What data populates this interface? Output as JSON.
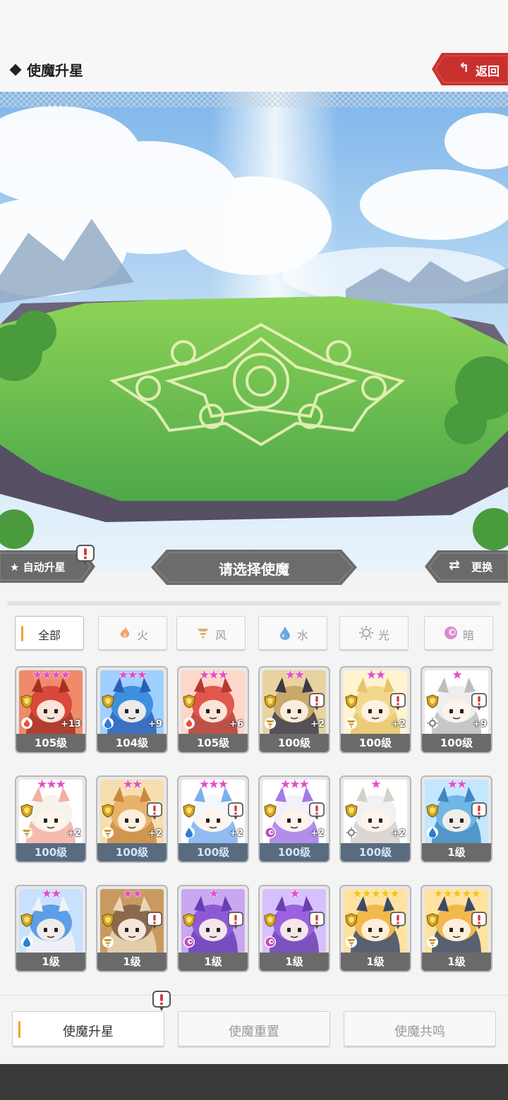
{
  "header": {
    "title": "使魔升星",
    "back_label": "返回"
  },
  "scene": {
    "auto_label": "自动升星",
    "select_label": "请选择使魔",
    "swap_label": "更换"
  },
  "filters": [
    {
      "label": "全部",
      "icon": "all",
      "active": true
    },
    {
      "label": "火",
      "icon": "fire-icon"
    },
    {
      "label": "风",
      "icon": "wind-icon"
    },
    {
      "label": "水",
      "icon": "water-icon"
    },
    {
      "label": "光",
      "icon": "light-icon"
    },
    {
      "label": "暗",
      "icon": "dark-icon"
    }
  ],
  "cards": [
    {
      "level": "105级",
      "stars": 4,
      "star_color": "pink",
      "plus": "+13",
      "element": "fire",
      "alert": false,
      "palette": [
        "#d9483a",
        "#a63024",
        "#f08a6a"
      ]
    },
    {
      "level": "104级",
      "stars": 3,
      "star_color": "pink",
      "plus": "+9",
      "element": "water",
      "alert": false,
      "palette": [
        "#3f8fe0",
        "#2a5fb5",
        "#9fd0ff"
      ]
    },
    {
      "level": "105级",
      "stars": 3,
      "star_color": "pink",
      "plus": "+6",
      "element": "fire",
      "alert": false,
      "palette": [
        "#e2574c",
        "#b33a30",
        "#ffd7c8"
      ]
    },
    {
      "level": "100级",
      "stars": 2,
      "star_color": "pink",
      "plus": "+2",
      "element": "wind",
      "alert": true,
      "palette": [
        "#c9a86a",
        "#3b3a4a",
        "#e8d3a0"
      ]
    },
    {
      "level": "100级",
      "stars": 2,
      "star_color": "pink",
      "plus": "+2",
      "element": "wind",
      "alert": true,
      "palette": [
        "#f1d88a",
        "#e6c46a",
        "#fff3d0"
      ]
    },
    {
      "level": "100级",
      "stars": 1,
      "star_color": "pink",
      "plus": "+9",
      "element": "light",
      "alert": true,
      "palette": [
        "#eeeeee",
        "#bdbdbd",
        "#ffffff"
      ]
    },
    {
      "level": "100级",
      "stars": 3,
      "star_color": "pink",
      "plus": "+2",
      "element": "wind",
      "alert": false,
      "palette": [
        "#f6f2ec",
        "#f3b0a0",
        "#ffffff"
      ]
    },
    {
      "level": "100级",
      "stars": 2,
      "star_color": "pink",
      "plus": "+2",
      "element": "wind",
      "alert": true,
      "palette": [
        "#e7b36a",
        "#c98a3e",
        "#f7deb0"
      ]
    },
    {
      "level": "100级",
      "stars": 3,
      "star_color": "pink",
      "plus": "+2",
      "element": "water",
      "alert": true,
      "palette": [
        "#f4f6fb",
        "#7cb0ee",
        "#ffffff"
      ]
    },
    {
      "level": "100级",
      "stars": 3,
      "star_color": "pink",
      "plus": "+2",
      "element": "dark",
      "alert": true,
      "palette": [
        "#f4f0fa",
        "#a47ae6",
        "#ffffff"
      ]
    },
    {
      "level": "100级",
      "stars": 1,
      "star_color": "pink",
      "plus": "+2",
      "element": "light",
      "alert": false,
      "palette": [
        "#f2f2f2",
        "#d6d0c8",
        "#ffffff"
      ]
    },
    {
      "level": "1级",
      "stars": 2,
      "star_color": "pink",
      "plus": "",
      "element": "water",
      "alert": true,
      "palette": [
        "#6fb7e6",
        "#3f87c0",
        "#c3e7ff"
      ]
    },
    {
      "level": "1级",
      "stars": 2,
      "star_color": "pink",
      "plus": "",
      "element": "water",
      "alert": false,
      "palette": [
        "#5d9fe6",
        "#f2f2f2",
        "#c8e1ff"
      ]
    },
    {
      "level": "1级",
      "stars": 2,
      "star_color": "pink",
      "plus": "",
      "element": "wind",
      "alert": true,
      "palette": [
        "#8a6a4a",
        "#e9d6b8",
        "#c99a60"
      ]
    },
    {
      "level": "1级",
      "stars": 1,
      "star_color": "pink",
      "plus": "",
      "element": "dark",
      "alert": true,
      "palette": [
        "#8c5ad6",
        "#6a3cb6",
        "#c8a8f0"
      ]
    },
    {
      "level": "1级",
      "stars": 1,
      "star_color": "pink",
      "plus": "",
      "element": "dark",
      "alert": true,
      "palette": [
        "#9a62e0",
        "#6b3fb0",
        "#d8c0ff"
      ]
    },
    {
      "level": "1级",
      "stars": 5,
      "star_color": "gold",
      "plus": "",
      "element": "wind",
      "alert": true,
      "palette": [
        "#f2b84b",
        "#3a4a6a",
        "#ffe2a0"
      ]
    },
    {
      "level": "1级",
      "stars": 5,
      "star_color": "gold",
      "plus": "",
      "element": "wind",
      "alert": true,
      "palette": [
        "#f2b84b",
        "#3a4a6a",
        "#ffe2a0"
      ]
    }
  ],
  "tabs": [
    {
      "label": "使魔升星",
      "active": true
    },
    {
      "label": "使魔重置",
      "active": false
    },
    {
      "label": "使魔共鸣",
      "active": false
    }
  ],
  "colors": {
    "accent": "#f0a133",
    "back_red": "#c8312e",
    "banner_gray": "#6c6c6c",
    "star_pink": "#e44cc9",
    "star_gold": "#f6c21d"
  }
}
